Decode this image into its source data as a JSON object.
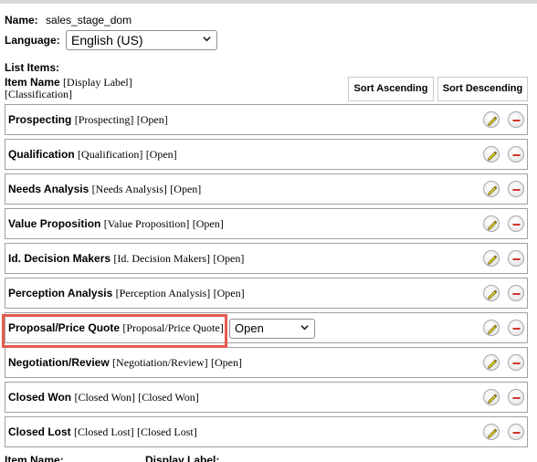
{
  "dropdown": {
    "name_label": "Name:",
    "name_value": "sales_stage_dom",
    "language_label": "Language:",
    "language_value": "English (US)"
  },
  "list": {
    "title": "List Items:",
    "header_name": "Item Name",
    "header_display": "[Display Label]",
    "header_class": "[Classification]",
    "sort_ascending": "Sort Ascending",
    "sort_descending": "Sort Descending",
    "items": [
      {
        "name": "Prospecting",
        "display": "[Prospecting]",
        "class": "[Open]"
      },
      {
        "name": "Qualification",
        "display": "[Qualification]",
        "class": "[Open]"
      },
      {
        "name": "Needs Analysis",
        "display": "[Needs Analysis]",
        "class": "[Open]"
      },
      {
        "name": "Value Proposition",
        "display": "[Value Proposition]",
        "class": "[Open]"
      },
      {
        "name": "Id. Decision Makers",
        "display": "[Id. Decision Makers]",
        "class": "[Open]"
      },
      {
        "name": "Perception Analysis",
        "display": "[Perception Analysis]",
        "class": "[Open]"
      },
      {
        "name": "Proposal/Price Quote",
        "display": "[Proposal/Price Quote]",
        "class": "",
        "classification_select": "Open"
      },
      {
        "name": "Negotiation/Review",
        "display": "[Negotiation/Review]",
        "class": "[Open]"
      },
      {
        "name": "Closed Won",
        "display": "[Closed Won]",
        "class": "[Closed Won]"
      },
      {
        "name": "Closed Lost",
        "display": "[Closed Lost]",
        "class": "[Closed Lost]"
      }
    ]
  },
  "footer": {
    "item_name_label": "Item Name:",
    "display_label_label": "Display Label:"
  },
  "icons": {
    "edit": "pencil-icon",
    "delete": "minus-circle-icon"
  },
  "colors": {
    "highlight": "#e55a50",
    "delete_red": "#d0342c",
    "pencil_yellow": "#f1e33a"
  }
}
